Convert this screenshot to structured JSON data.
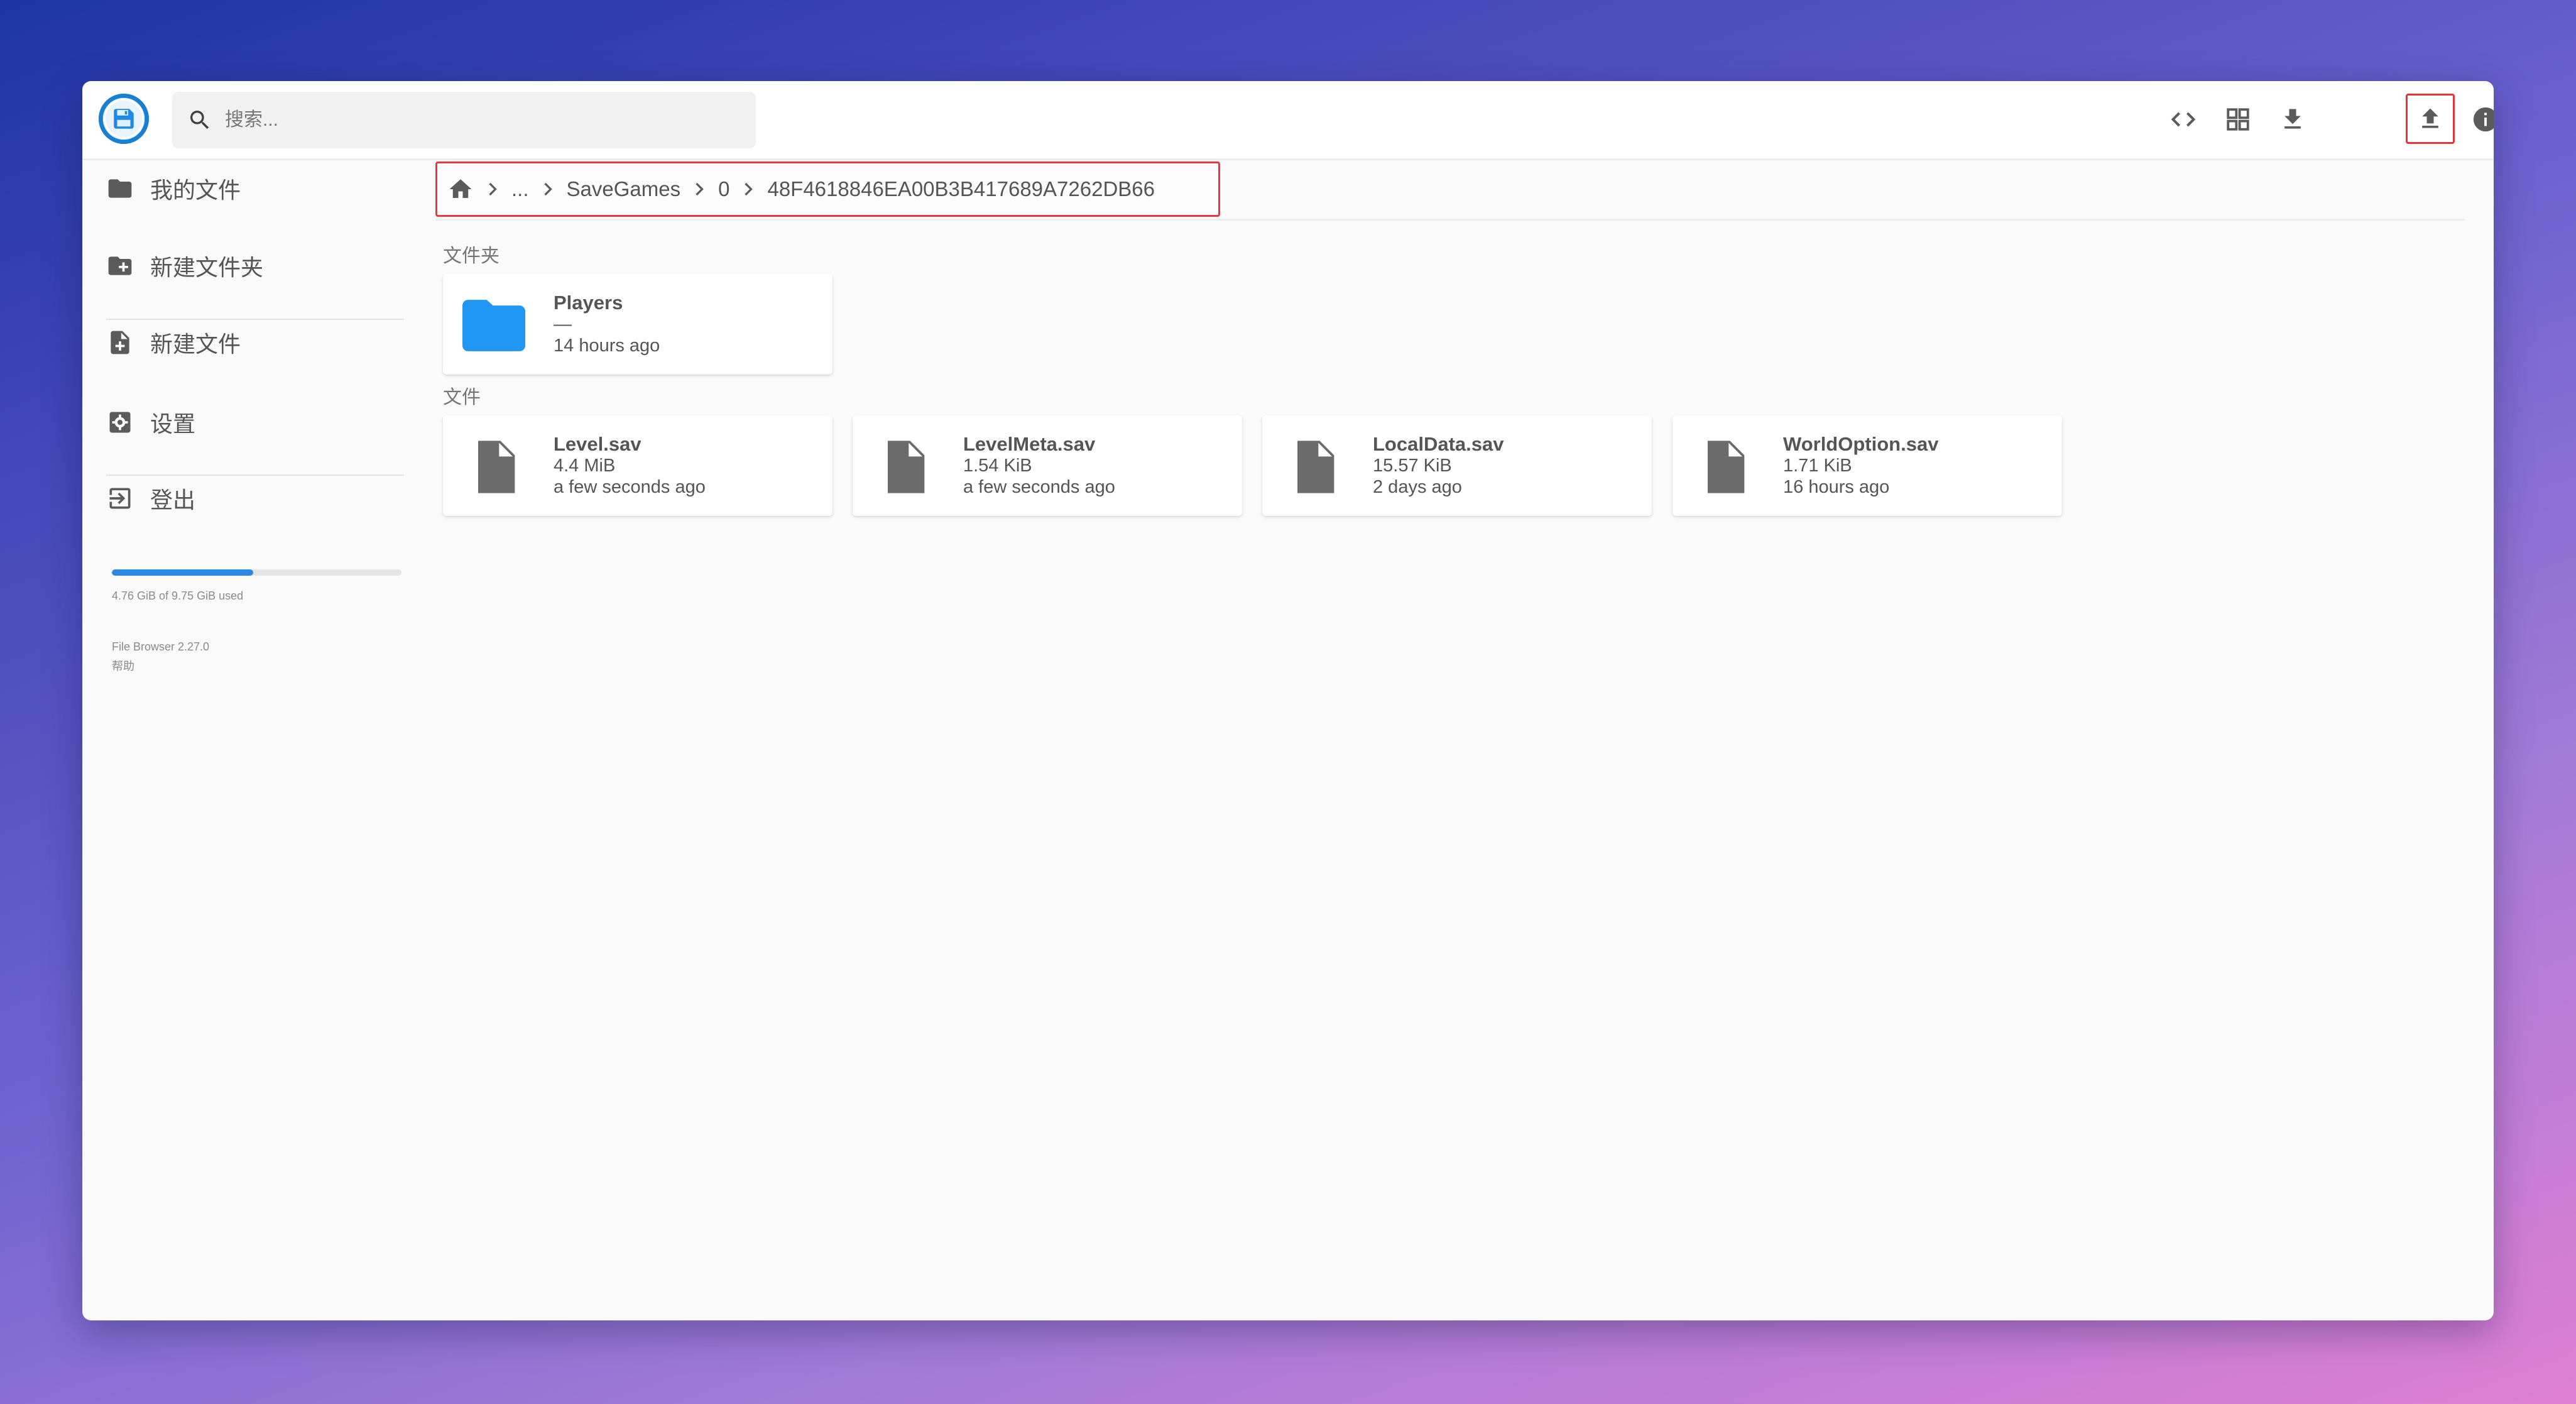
{
  "header": {
    "search_placeholder": "搜索...",
    "toolbar": [
      {
        "name": "code-view-button",
        "icon": "code-icon"
      },
      {
        "name": "grid-view-button",
        "icon": "grid-icon"
      },
      {
        "name": "download-button",
        "icon": "download-icon"
      },
      {
        "name": "upload-button",
        "icon": "upload-icon",
        "highlighted": true
      },
      {
        "name": "info-button",
        "icon": "info-icon"
      },
      {
        "name": "select-button",
        "icon": "check-circle-icon"
      }
    ]
  },
  "sidebar": {
    "items": [
      {
        "label": "我的文件",
        "icon": "folder-icon"
      },
      {
        "label": "新建文件夹",
        "icon": "new-folder-icon"
      },
      {
        "label": "新建文件",
        "icon": "new-file-icon"
      },
      {
        "label": "设置",
        "icon": "settings-icon"
      },
      {
        "label": "登出",
        "icon": "logout-icon"
      }
    ],
    "storage": {
      "used_fraction": 0.488,
      "text": "4.76 GiB of 9.75 GiB used"
    },
    "footer": {
      "version": "File Browser 2.27.0",
      "help": "帮助"
    }
  },
  "breadcrumb": {
    "home_icon": "home-icon",
    "items": [
      "...",
      "SaveGames",
      "0",
      "48F4618846EA00B3B417689A7262DB66"
    ]
  },
  "sections": {
    "folders_label": "文件夹",
    "files_label": "文件"
  },
  "folders": [
    {
      "name": "Players",
      "size": "—",
      "modified": "14 hours ago"
    }
  ],
  "files": [
    {
      "name": "Level.sav",
      "size": "4.4 MiB",
      "modified": "a few seconds ago"
    },
    {
      "name": "LevelMeta.sav",
      "size": "1.54 KiB",
      "modified": "a few seconds ago"
    },
    {
      "name": "LocalData.sav",
      "size": "15.57 KiB",
      "modified": "2 days ago"
    },
    {
      "name": "WorldOption.sav",
      "size": "1.71 KiB",
      "modified": "16 hours ago"
    }
  ],
  "colors": {
    "accent": "#2196f3",
    "highlight_border": "#e33a45",
    "icon_gray": "#5b5b5b"
  }
}
